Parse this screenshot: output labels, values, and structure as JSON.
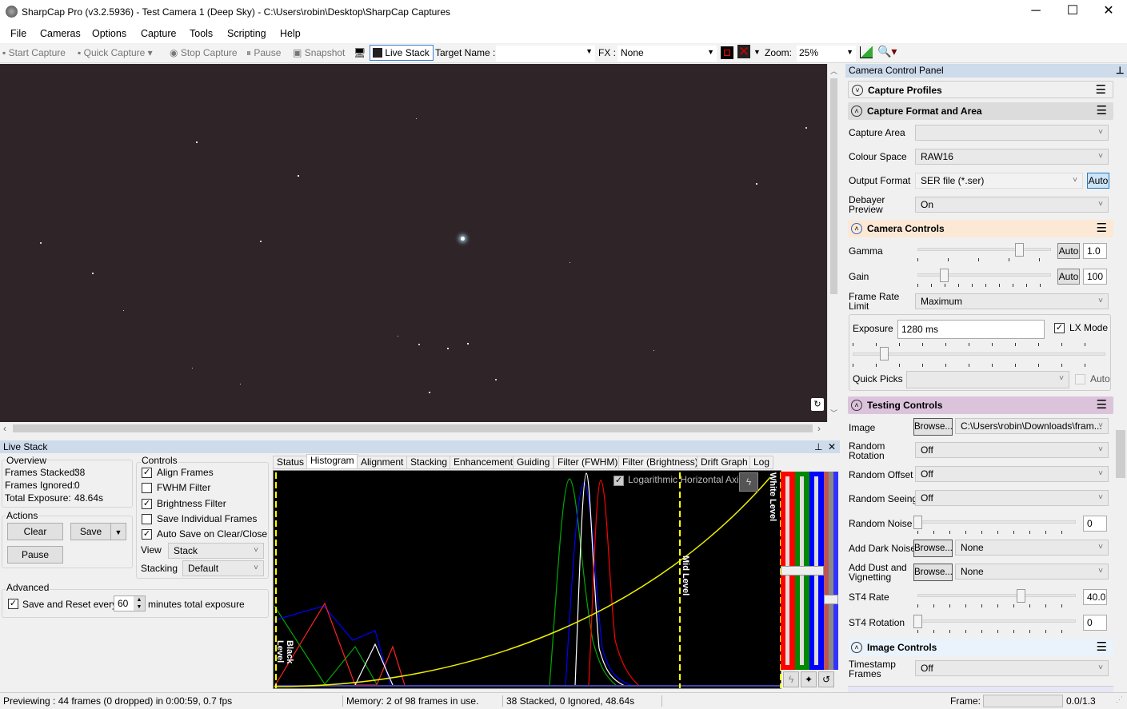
{
  "window": {
    "title": "SharpCap Pro (v3.2.5936) - Test Camera 1 (Deep Sky) - C:\\Users\\robin\\Desktop\\SharpCap Captures",
    "minimize": "─",
    "maximize": "☐",
    "close": "✕"
  },
  "menu": [
    "File",
    "Cameras",
    "Options",
    "Capture",
    "Tools",
    "Scripting",
    "Help"
  ],
  "toolbar": {
    "start_capture": "Start Capture",
    "quick_capture": "Quick Capture",
    "stop_capture": "Stop Capture",
    "pause": "Pause",
    "snapshot": "Snapshot",
    "live_stack": "Live Stack",
    "target_name_label": "Target Name :",
    "target_name_value": "",
    "fx_label": "FX :",
    "fx_value": "None",
    "zoom_label": "Zoom:",
    "zoom_value": "25%"
  },
  "live_stack": {
    "title": "Live Stack",
    "overview": {
      "title": "Overview",
      "frames_stacked_label": "Frames Stacked:",
      "frames_stacked": "38",
      "frames_ignored_label": "Frames Ignored:",
      "frames_ignored": "0",
      "total_exposure_label": "Total Exposure:",
      "total_exposure": "48.64s"
    },
    "actions": {
      "title": "Actions",
      "clear": "Clear",
      "save": "Save",
      "pause": "Pause"
    },
    "controls": {
      "title": "Controls",
      "checkboxes": [
        {
          "label": "Align Frames",
          "checked": true
        },
        {
          "label": "FWHM Filter",
          "checked": false
        },
        {
          "label": "Brightness Filter",
          "checked": true
        },
        {
          "label": "Save Individual Frames",
          "checked": false
        },
        {
          "label": "Auto Save on Clear/Close",
          "checked": true
        }
      ],
      "view_label": "View",
      "view_value": "Stack",
      "stacking_label": "Stacking",
      "stacking_value": "Default"
    },
    "advanced": {
      "title": "Advanced",
      "save_reset_label": "Save and Reset every",
      "save_reset_checked": true,
      "minutes_value": "60",
      "minutes_suffix": "minutes total exposure"
    },
    "tabs": [
      "Status",
      "Histogram",
      "Alignment",
      "Stacking",
      "Enhancement",
      "Guiding",
      "Filter (FWHM)",
      "Filter (Brightness)",
      "Drift Graph",
      "Log"
    ],
    "active_tab": "Histogram",
    "histogram": {
      "log_axis_label": "Logarithmic Horizontal Axis",
      "log_axis_checked": true,
      "black_level": "Black Level",
      "mid_level": "Mid Level",
      "white_level": "White Level",
      "colors": {
        "red": "#ff0000",
        "green": "#008000",
        "blue": "#0000ff",
        "curve": "#ffff00"
      }
    }
  },
  "camera_panel": {
    "title": "Camera Control Panel",
    "sections": {
      "capture_profiles": "Capture Profiles",
      "capture_format": "Capture Format and Area",
      "camera_controls": "Camera Controls",
      "testing_controls": "Testing Controls",
      "image_controls": "Image Controls"
    },
    "capture_format": {
      "capture_area_label": "Capture Area",
      "capture_area": "",
      "colour_space_label": "Colour Space",
      "colour_space": "RAW16",
      "output_format_label": "Output Format",
      "output_format": "SER file (*.ser)",
      "auto": "Auto",
      "debayer_label": "Debayer Preview",
      "debayer": "On"
    },
    "camera_controls": {
      "gamma_label": "Gamma",
      "gamma": "1.0",
      "gain_label": "Gain",
      "gain": "100",
      "auto": "Auto",
      "frame_rate_label": "Frame Rate Limit",
      "frame_rate": "Maximum",
      "exposure_label": "Exposure",
      "exposure": "1280 ms",
      "lx_mode_label": "LX Mode",
      "lx_mode": true,
      "quick_picks_label": "Quick Picks",
      "quick_picks": "",
      "quick_auto": "Auto"
    },
    "testing": {
      "image_label": "Image",
      "browse": "Browse...",
      "image_path": "C:\\Users\\robin\\Downloads\\fram...",
      "random_rotation_label": "Random Rotation",
      "random_rotation": "Off",
      "random_offset_label": "Random Offset",
      "random_offset": "Off",
      "random_seeing_label": "Random Seeing",
      "random_seeing": "Off",
      "random_noise_label": "Random Noise",
      "random_noise": "0",
      "dark_noise_label": "Add Dark Noise",
      "dark_noise": "None",
      "dust_label": "Add Dust and Vignetting",
      "dust": "None",
      "st4_rate_label": "ST4 Rate",
      "st4_rate": "40.0",
      "st4_rotation_label": "ST4 Rotation",
      "st4_rotation": "0"
    },
    "image_controls": {
      "timestamp_label": "Timestamp Frames",
      "timestamp": "Off"
    }
  },
  "status": {
    "preview": "Previewing : 44 frames (0 dropped) in 0:00:59, 0.7 fps",
    "memory": "Memory: 2 of 98 frames in use.",
    "stacked": "38 Stacked, 0 Ignored, 48.64s",
    "frame_label": "Frame:",
    "frame_value": "0.0/1.3"
  }
}
